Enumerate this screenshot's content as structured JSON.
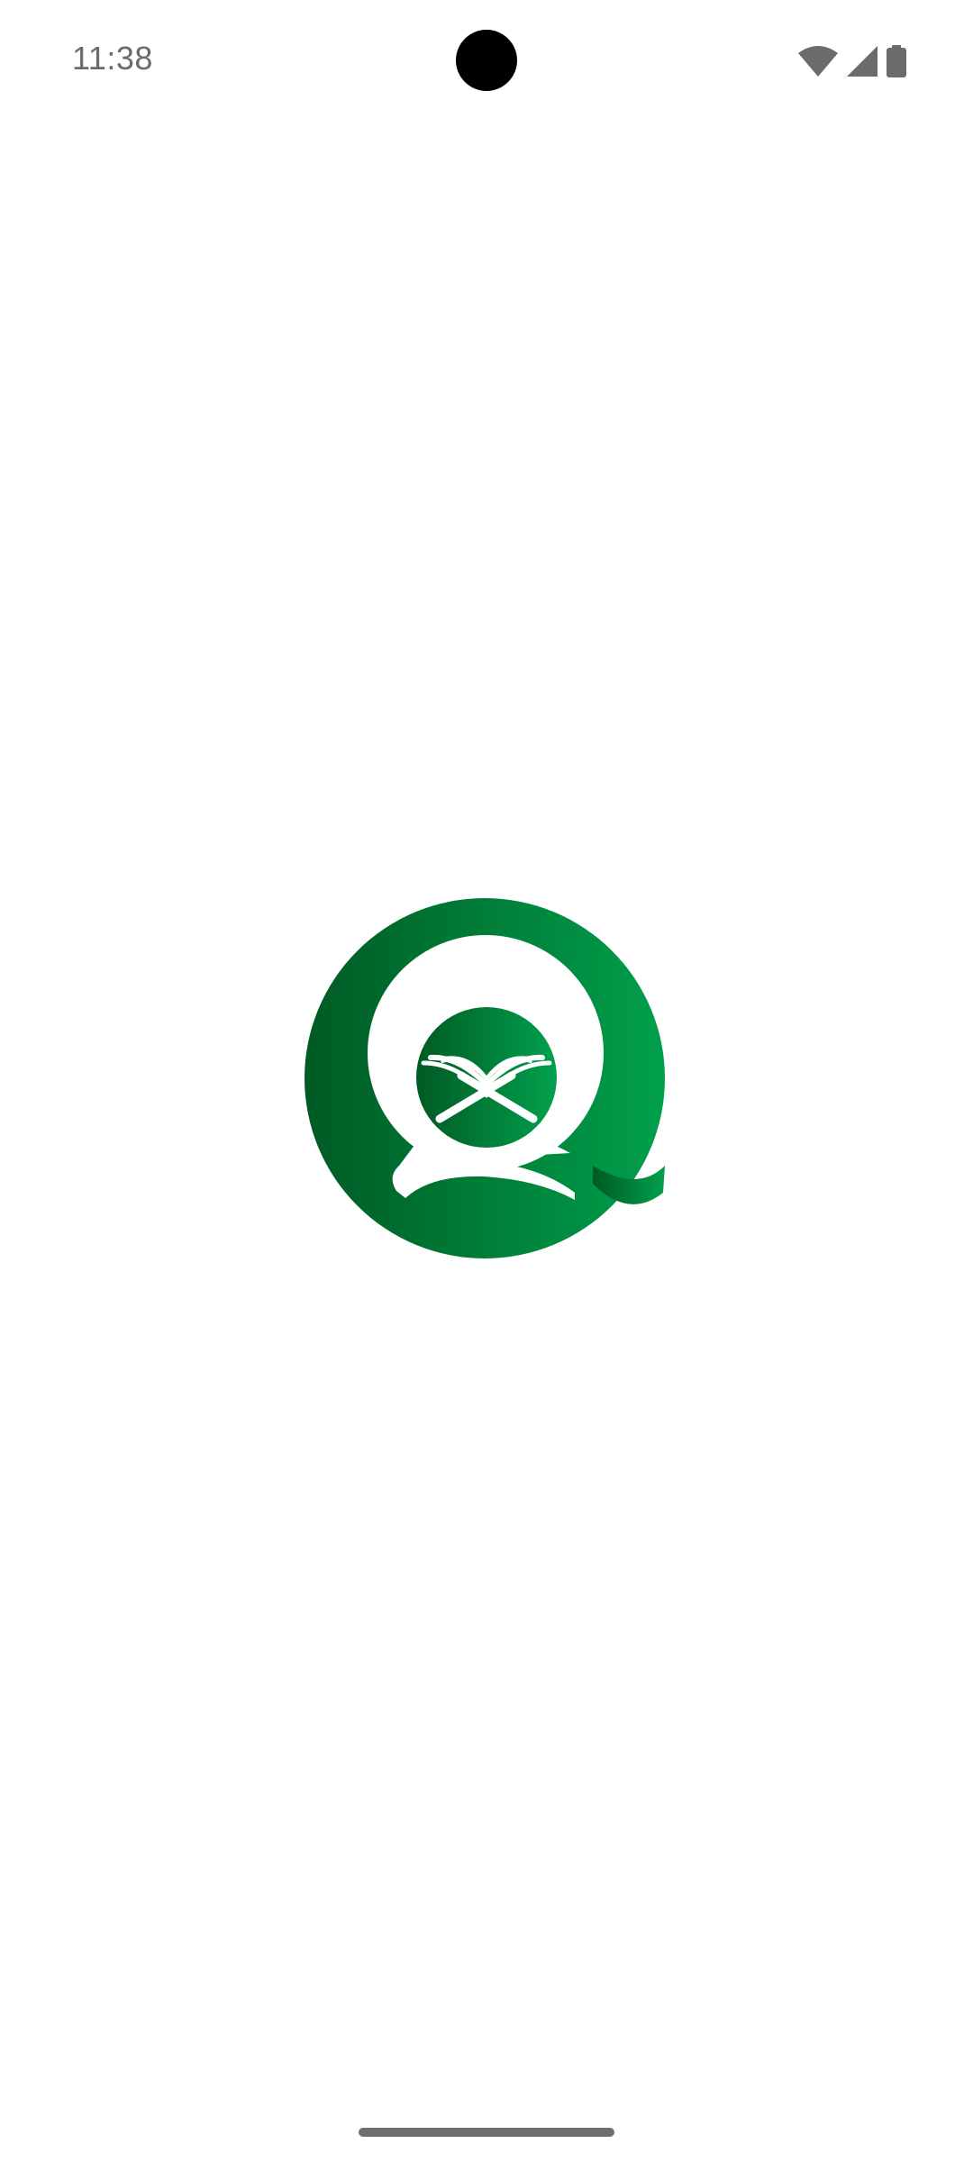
{
  "status_bar": {
    "time": "11:38",
    "icons": [
      "wifi-icon",
      "cellular-signal-icon",
      "battery-icon"
    ]
  },
  "splash": {
    "logo_icon": "quran-app-logo",
    "colors": {
      "gradient_dark": "#005a24",
      "gradient_light": "#00a04c",
      "glyph": "#ffffff"
    }
  },
  "navigation": {
    "gesture_handle": "gesture-navigation-handle"
  }
}
